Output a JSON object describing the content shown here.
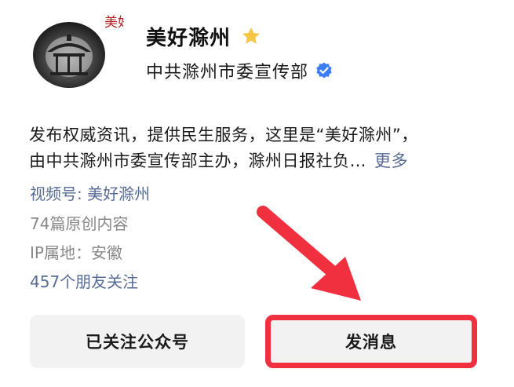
{
  "profile": {
    "avatar_text": "美好滁州",
    "name": "美好滁州",
    "organization": "中共滁州市委宣传部"
  },
  "description": {
    "line1": "发布权威资讯，提供民生服务，这里是“美好滁州”，",
    "line2": "由中共滁州市委宣传部主办，滁州日报社负…",
    "more_label": "更多"
  },
  "meta": {
    "channel": "视频号: 美好滁州",
    "original_posts": "74篇原创内容",
    "ip_location": "IP属地：安徽",
    "friends_following": "457个朋友关注"
  },
  "actions": {
    "followed_label": "已关注公众号",
    "message_label": "发消息"
  },
  "colors": {
    "link": "#576b95",
    "verified": "#3d7ef6",
    "star": "#f6c544",
    "highlight": "#f0303e"
  }
}
